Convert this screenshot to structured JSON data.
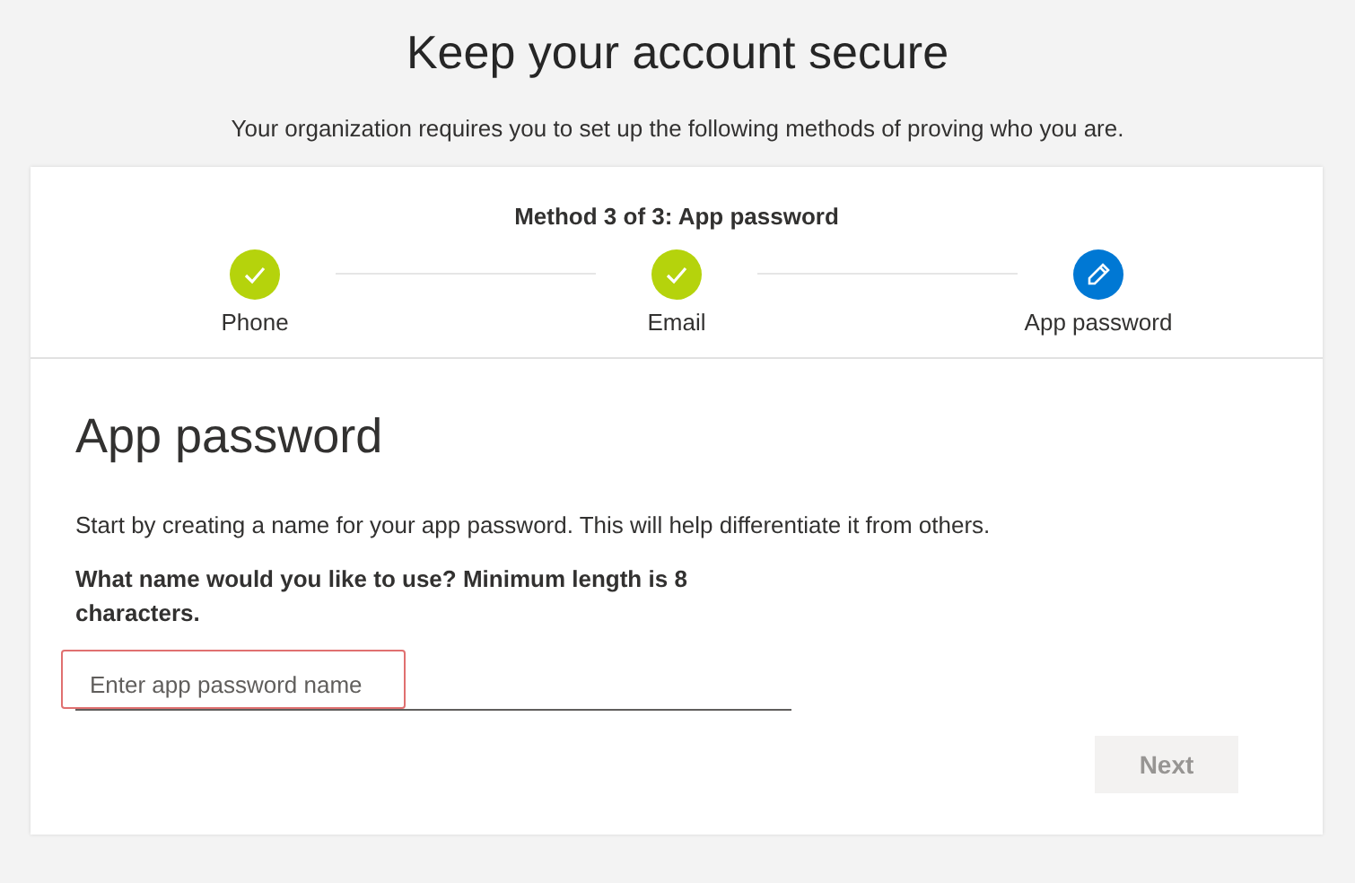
{
  "page": {
    "title": "Keep your account secure",
    "subtitle": "Your organization requires you to set up the following methods of proving who you are."
  },
  "progress": {
    "heading": "Method 3 of 3: App password",
    "steps": [
      {
        "label": "Phone",
        "completed": true
      },
      {
        "label": "Email",
        "completed": true
      },
      {
        "label": "App password",
        "completed": false
      }
    ]
  },
  "form": {
    "title": "App password",
    "description": "Start by creating a name for your app password. This will help differentiate it from others.",
    "question": "What name would you like to use? Minimum length is 8 characters.",
    "field": {
      "placeholder": "Enter app password name",
      "highlighted": true
    },
    "buttons": [
      {
        "label": "Next",
        "disabled": true
      }
    ]
  }
}
